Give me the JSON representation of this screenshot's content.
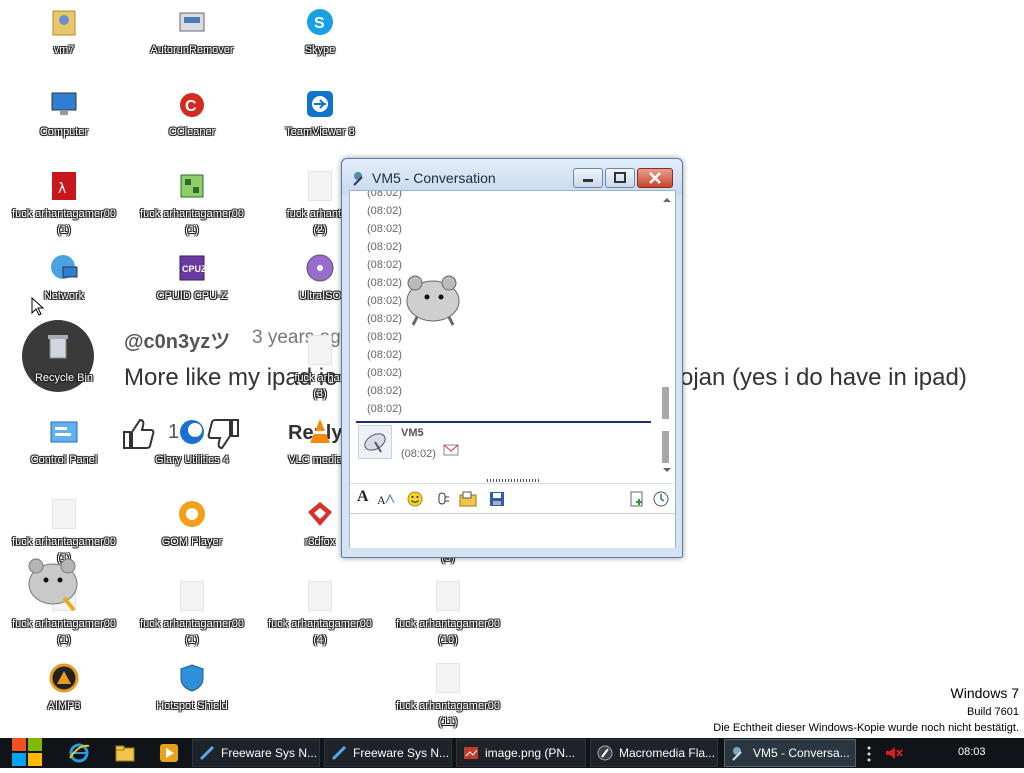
{
  "desktop_icons": [
    {
      "id": "vm7",
      "label": "vm7"
    },
    {
      "id": "autorun",
      "label": "AutorunRemover"
    },
    {
      "id": "skype",
      "label": "Skype"
    },
    {
      "id": "computer",
      "label": "Computer"
    },
    {
      "id": "ccleaner",
      "label": "CCleaner"
    },
    {
      "id": "teamviewer",
      "label": "TeamViewer 8"
    },
    {
      "id": "pdf1",
      "label": "fuck arhantagamer00\n(1)"
    },
    {
      "id": "exe1",
      "label": "fuck arhantagamer00\n(1)"
    },
    {
      "id": "blank2",
      "label": "fuck arhantag\n(2)"
    },
    {
      "id": "network",
      "label": "Network"
    },
    {
      "id": "cpuz",
      "label": "CPUID CPU-Z"
    },
    {
      "id": "ultraiso",
      "label": "UltraISO"
    },
    {
      "id": "recycle",
      "label": "Recycle Bin"
    },
    {
      "id": "blank3",
      "label": "fuck arhan\n(3)"
    },
    {
      "id": "control",
      "label": "Control Panel"
    },
    {
      "id": "glary",
      "label": "Glary Utilities 4"
    },
    {
      "id": "vlc",
      "label": "VLC media p"
    },
    {
      "id": "blankA",
      "label": "fuck arhantagamer00\n(1)"
    },
    {
      "id": "gom",
      "label": "GOM Player"
    },
    {
      "id": "r3dfox",
      "label": "r3dfox"
    },
    {
      "id": "blank9",
      "label": "(9)"
    },
    {
      "id": "blankB",
      "label": "fuck arhantagamer00\n(1)"
    },
    {
      "id": "blankC",
      "label": "fuck arhantagamer00\n(1)"
    },
    {
      "id": "blank4",
      "label": "fuck arhantagamer00\n(4)"
    },
    {
      "id": "blank10",
      "label": "fuck arhantagamer00\n(10)"
    },
    {
      "id": "aimp",
      "label": "AIMP3"
    },
    {
      "id": "hotspot",
      "label": "Hotspot Shield"
    },
    {
      "id": "blank11",
      "label": "fuck arhantagamer00\n(11)"
    }
  ],
  "yt_overlay": {
    "username": "@c0n3yzツ",
    "time": "3 years ag",
    "text_left": "More like my ipad ie",
    "text_right": "ojan (yes i do have in ipad)",
    "likes": "1",
    "reply": "Reply"
  },
  "messenger": {
    "title": "VM5 - Conversation",
    "timestamps": [
      "(08:02)",
      "(08:02)",
      "(08:02)",
      "(08:02)",
      "(08:02)",
      "(08:02)",
      "(08:02)",
      "(08:02)",
      "(08:02)",
      "(08:02)",
      "(08:02)",
      "(08:02)",
      "(08:02)"
    ],
    "contact_name": "VM5",
    "contact_time": "(08:02)"
  },
  "watermark": {
    "line1": "Windows 7",
    "line2": "Build 7601",
    "line3": "Die Echtheit dieser Windows-Kopie wurde noch nicht bestätigt."
  },
  "taskbar": {
    "tasks": [
      {
        "label": "Freeware Sys N...",
        "icon": "app-icon"
      },
      {
        "label": "Freeware Sys N...",
        "icon": "app-icon"
      },
      {
        "label": "image.png (PN...",
        "icon": "image-icon"
      },
      {
        "label": "Macromedia Fla...",
        "icon": "flash-icon"
      },
      {
        "label": "VM5 - Conversa...",
        "icon": "messenger-icon"
      }
    ],
    "clock": "08:03"
  },
  "colors": {
    "taskbar": "#101418",
    "title_text": "#1e2b3c",
    "close": "#c8432c"
  }
}
